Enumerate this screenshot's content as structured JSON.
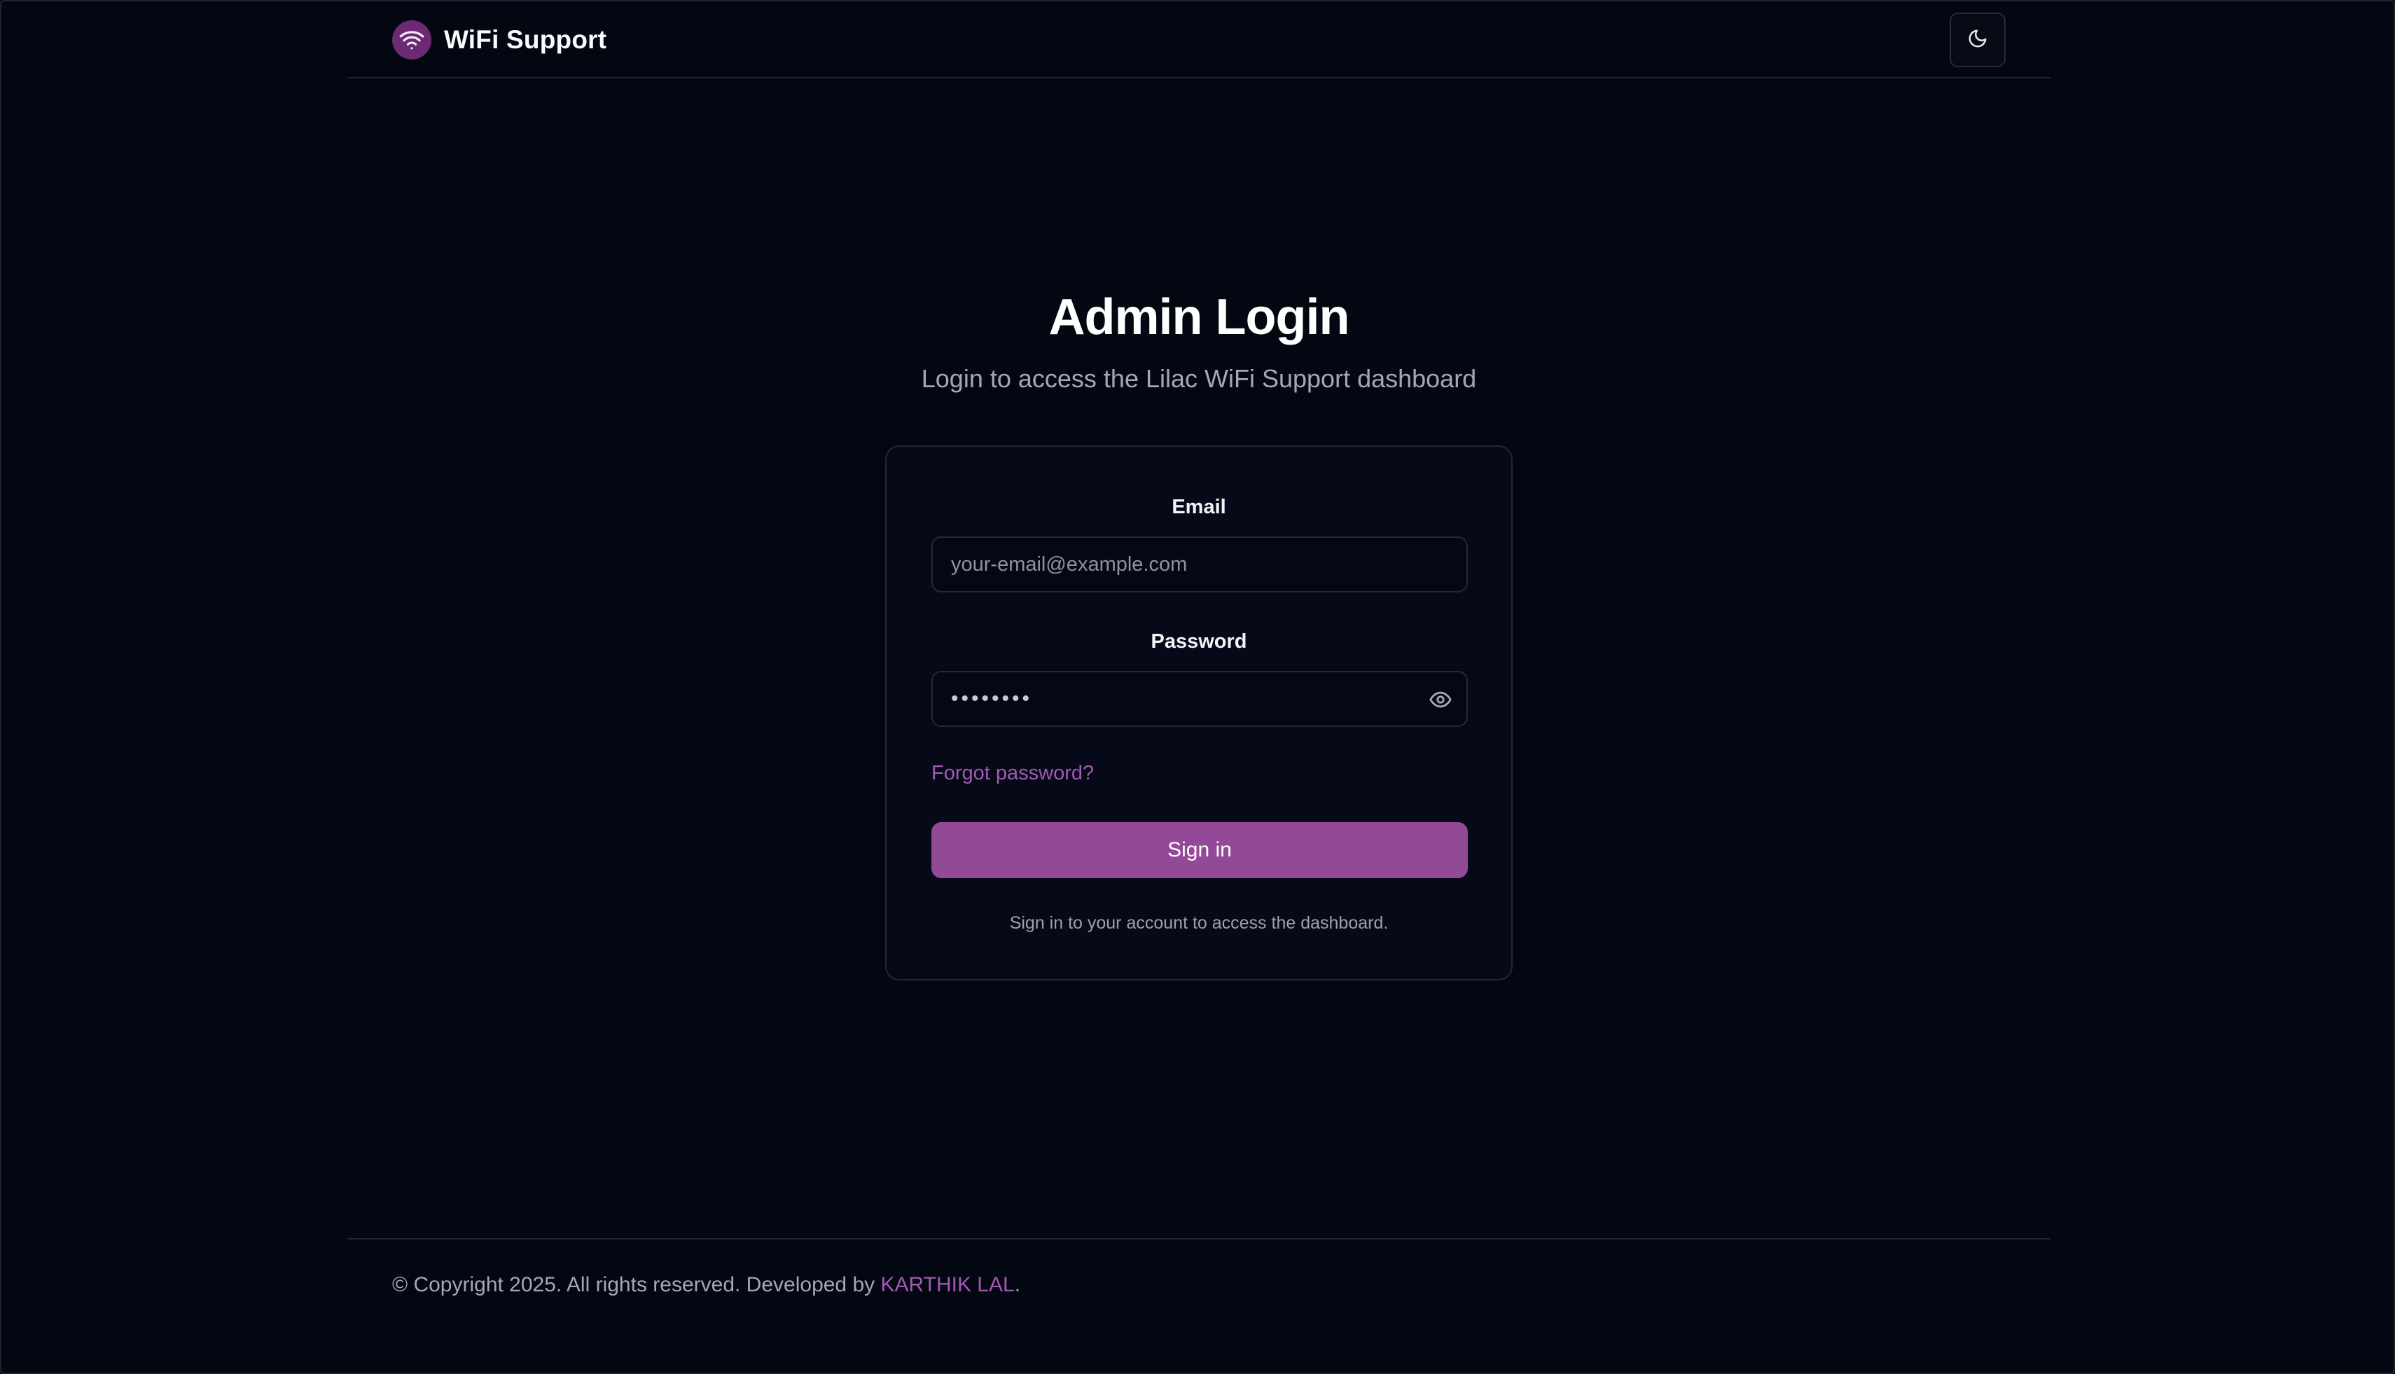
{
  "header": {
    "brand_name": "WiFi Support",
    "logo_icon": "wifi-icon",
    "theme_toggle_icon": "moon-icon"
  },
  "page": {
    "title": "Admin Login",
    "subtitle": "Login to access the Lilac WiFi Support dashboard"
  },
  "form": {
    "email_label": "Email",
    "email_placeholder": "your-email@example.com",
    "email_value": "",
    "password_label": "Password",
    "password_value_masked": "••••••••",
    "password_toggle_icon": "eye-icon",
    "forgot_link": "Forgot password?",
    "submit_label": "Sign in",
    "hint": "Sign in to your account to access the dashboard."
  },
  "footer": {
    "prefix": "© Copyright 2025. All rights reserved. Developed by ",
    "author_link": "KARTHIK LAL",
    "suffix": "."
  },
  "colors": {
    "background": "#030712",
    "accent": "#934898",
    "link": "#a25ab0",
    "logo_bg": "#6b2a72"
  }
}
